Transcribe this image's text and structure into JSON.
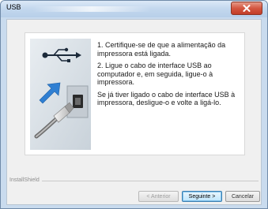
{
  "window": {
    "title": "USB"
  },
  "content": {
    "step1": "1. Certifique-se de que a alimentação da impressora está ligada.",
    "step2": "2. Ligue o cabo de interface USB ao computador e, em seguida, ligue-o à impressora.",
    "note": "Se já tiver ligado o cabo de interface USB à impressora, desligue-o e volte a ligá-lo."
  },
  "footer": {
    "installshield": "InstallShield"
  },
  "buttons": {
    "back": "< Anterior",
    "next": "Seguinte >",
    "cancel": "Cancelar"
  },
  "colors": {
    "accent": "#3c7fb1",
    "close": "#c23d28",
    "arrow": "#2f7fd2"
  },
  "icons": [
    "usb-symbol-icon",
    "close-icon",
    "arrow-icon"
  ]
}
